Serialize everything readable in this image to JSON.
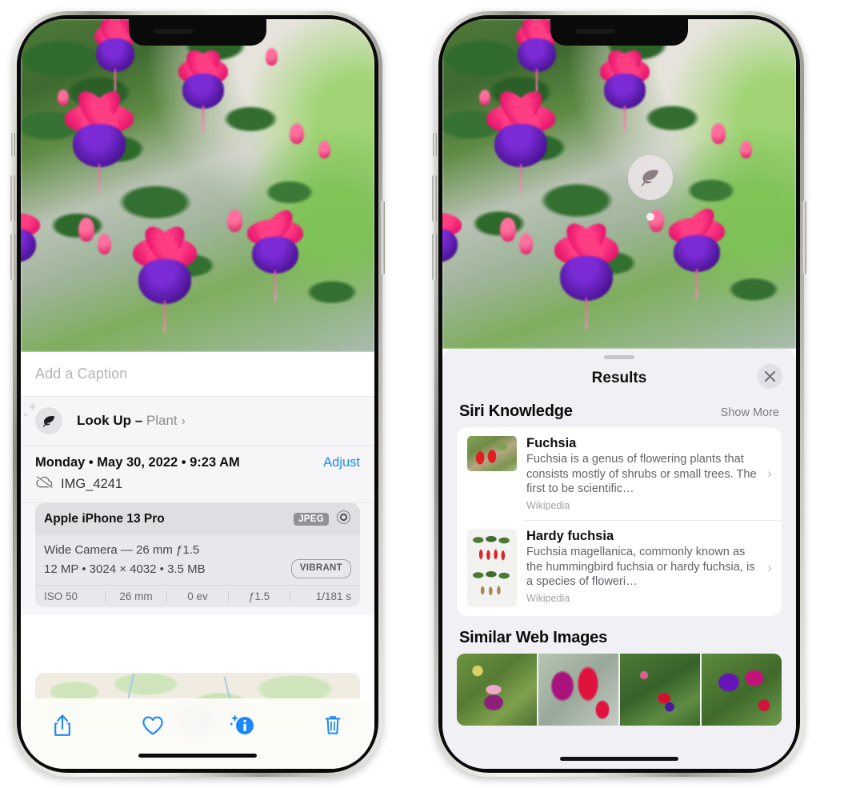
{
  "left_phone": {
    "caption_field": {
      "placeholder": "Add a Caption",
      "value": ""
    },
    "lookup_row": {
      "icon": "leaf-icon",
      "label": "Look Up –",
      "subject": "Plant",
      "chevron": "›"
    },
    "metadata": {
      "date_line": "Monday • May 30, 2022 • 9:23 AM",
      "adjust_label": "Adjust",
      "cloud_icon": "cloud-slash-icon",
      "filename": "IMG_4241"
    },
    "exif": {
      "device": "Apple iPhone 13 Pro",
      "format_tag": "JPEG",
      "lens_icon": "aperture-icon",
      "lens_line": "Wide Camera — 26 mm ƒ1.5",
      "size_line": "12 MP • 3024 × 4032 • 3.5 MB",
      "style_tag": "VIBRANT",
      "stats": [
        "ISO 50",
        "26 mm",
        "0 ev",
        "ƒ1.5",
        "1/181 s"
      ]
    },
    "toolbar": [
      {
        "name": "share-button",
        "icon": "share-icon"
      },
      {
        "name": "favorite-button",
        "icon": "heart-icon"
      },
      {
        "name": "info-button",
        "icon": "info-sparkle-icon"
      },
      {
        "name": "delete-button",
        "icon": "trash-icon"
      }
    ]
  },
  "right_phone": {
    "pin": {
      "icon": "leaf-icon"
    },
    "sheet": {
      "title": "Results",
      "close_icon": "close-icon",
      "sections": [
        {
          "title": "Siri Knowledge",
          "action": "Show More"
        },
        {
          "title": "Similar Web Images",
          "action": ""
        }
      ]
    },
    "knowledge_cards": [
      {
        "title": "Fuchsia",
        "description": "Fuchsia is a genus of flowering plants that consists mostly of shrubs or small trees. The first to be scientific…",
        "source": "Wikipedia",
        "chevron": "›"
      },
      {
        "title": "Hardy fuchsia",
        "description": "Fuchsia magellanica, commonly known as the hummingbird fuchsia or hardy fuchsia, is a species of floweri…",
        "source": "Wikipedia",
        "chevron": "›"
      }
    ],
    "web_images": [
      "web-image-1",
      "web-image-2",
      "web-image-3",
      "web-image-4"
    ]
  },
  "colors": {
    "accent_blue": "#1a87fb",
    "sheet_bg": "#f0f0f5",
    "card_bg": "#ffffff",
    "muted_text": "#8d8d93"
  }
}
